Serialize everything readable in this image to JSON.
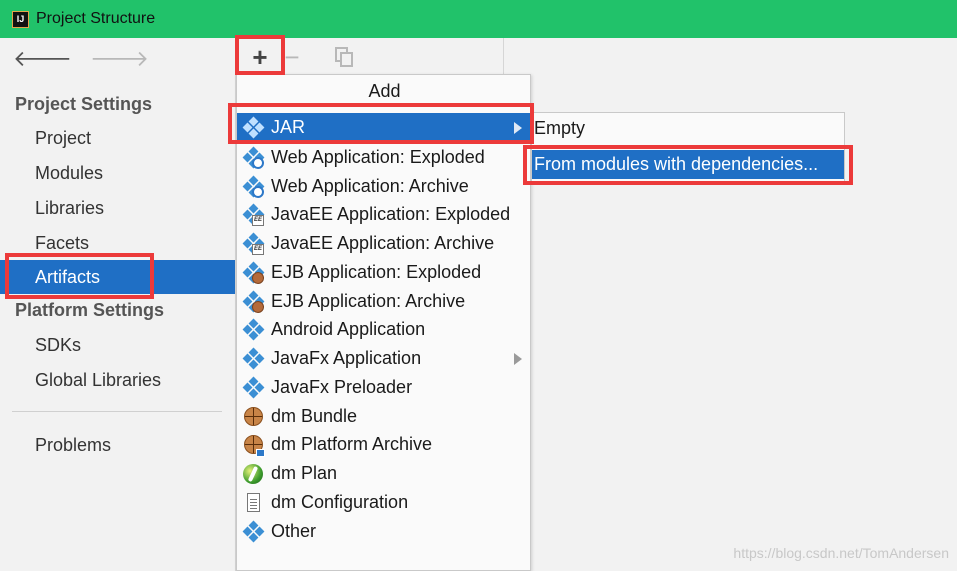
{
  "window": {
    "title": "Project Structure",
    "logo_text": "IJ"
  },
  "nav": {
    "back_glyph": "🡐",
    "forward_glyph": "🡒"
  },
  "sidebar": {
    "project_settings_title": "Project Settings",
    "project_items": [
      {
        "label": "Project"
      },
      {
        "label": "Modules"
      },
      {
        "label": "Libraries"
      },
      {
        "label": "Facets"
      },
      {
        "label": "Artifacts",
        "selected": true
      }
    ],
    "platform_settings_title": "Platform Settings",
    "platform_items": [
      {
        "label": "SDKs"
      },
      {
        "label": "Global Libraries"
      }
    ],
    "problems_label": "Problems"
  },
  "toolbar": {
    "add_glyph": "+",
    "remove_glyph": "−",
    "copy_icon": "copy-icon"
  },
  "add_menu": {
    "header": "Add",
    "items": [
      {
        "label": "JAR",
        "icon": "jar-icon",
        "has_submenu": true,
        "highlighted": true
      },
      {
        "label": "Web Application: Exploded",
        "icon": "web-app-exploded-icon"
      },
      {
        "label": "Web Application: Archive",
        "icon": "web-app-archive-icon"
      },
      {
        "label": "JavaEE Application: Exploded",
        "icon": "javaee-exploded-icon"
      },
      {
        "label": "JavaEE Application: Archive",
        "icon": "javaee-archive-icon"
      },
      {
        "label": "EJB Application: Exploded",
        "icon": "ejb-exploded-icon"
      },
      {
        "label": "EJB Application: Archive",
        "icon": "ejb-archive-icon"
      },
      {
        "label": "Android Application",
        "icon": "android-app-icon"
      },
      {
        "label": "JavaFx Application",
        "icon": "javafx-app-icon",
        "has_submenu": true
      },
      {
        "label": "JavaFx Preloader",
        "icon": "javafx-preloader-icon"
      },
      {
        "label": "dm Bundle",
        "icon": "dm-bundle-icon"
      },
      {
        "label": "dm Platform Archive",
        "icon": "dm-platform-archive-icon"
      },
      {
        "label": "dm Plan",
        "icon": "dm-plan-icon"
      },
      {
        "label": "dm Configuration",
        "icon": "dm-configuration-icon"
      },
      {
        "label": "Other",
        "icon": "other-icon"
      }
    ]
  },
  "jar_submenu": {
    "items": [
      {
        "label": "Empty"
      },
      {
        "label": "From modules with dependencies...",
        "highlighted": true
      }
    ]
  },
  "colors": {
    "titlebar": "#21c26a",
    "selection": "#1f6fc5",
    "annotation": "#ec3a3a"
  },
  "watermark": "https://blog.csdn.net/TomAndersen"
}
